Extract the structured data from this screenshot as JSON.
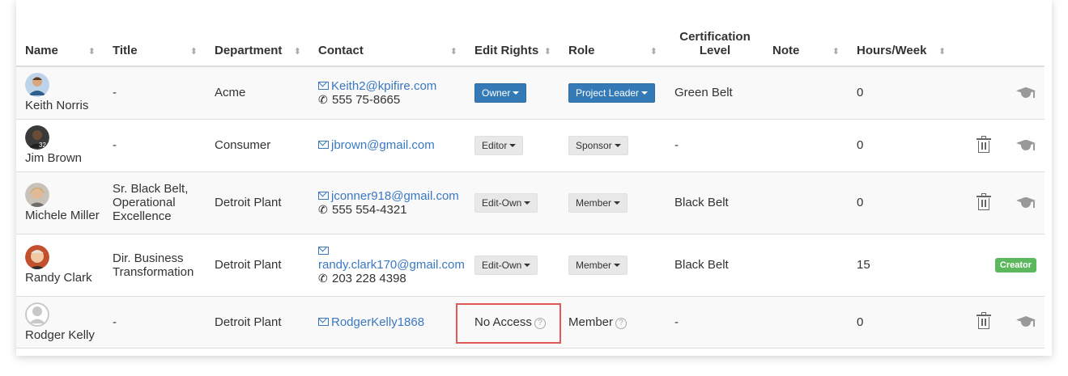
{
  "table": {
    "headers": {
      "name": "Name",
      "title": "Title",
      "department": "Department",
      "contact": "Contact",
      "edit_rights": "Edit Rights",
      "role": "Role",
      "certification_line1": "Certification",
      "certification_line2": "Level",
      "note": "Note",
      "hours": "Hours/Week"
    },
    "sort_glyph": "⬍",
    "rows": [
      {
        "name": "Keith Norris",
        "title": "-",
        "department": "Acme",
        "email": "Keith2@kpifire.com",
        "phone": "555 75-8665",
        "edit_rights": "Owner",
        "role": "Project Leader",
        "certification": "Green Belt",
        "hours": "0"
      },
      {
        "name": "Jim Brown",
        "title": "-",
        "department": "Consumer",
        "email": "jbrown@gmail.com",
        "edit_rights": "Editor",
        "role": "Sponsor",
        "certification": "-",
        "hours": "0"
      },
      {
        "name": "Michele Miller",
        "title_line1": "Sr. Black Belt,",
        "title_line2": "Operational",
        "title_line3": "Excellence",
        "department": "Detroit Plant",
        "email": "jconner918@gmail.com",
        "phone": "555 554-4321",
        "edit_rights": "Edit-Own",
        "role": "Member",
        "certification": "Black Belt",
        "hours": "0"
      },
      {
        "name": "Randy Clark",
        "title_line1": "Dir. Business",
        "title_line2": "Transformation",
        "department": "Detroit Plant",
        "email": "randy.clark170@gmail.com",
        "phone": "203 228 4398",
        "edit_rights": "Edit-Own",
        "role": "Member",
        "certification": "Black Belt",
        "hours": "15",
        "badge": "Creator"
      },
      {
        "name": "Rodger Kelly",
        "title": "-",
        "department": "Detroit Plant",
        "email": "RodgerKelly1868",
        "edit_rights": "No Access",
        "role": "Member",
        "certification": "-",
        "hours": "0"
      }
    ]
  },
  "icons": {
    "email": "envelope-icon",
    "phone": "phone-icon",
    "delete": "trash-icon",
    "certification": "graduation-cap-icon",
    "help": "question-circle-icon"
  },
  "help_glyph": "?",
  "colors": {
    "primary_button": "#337ab7",
    "link": "#3a78c2",
    "badge_green": "#5cb85c",
    "highlight_red": "#e05a5a"
  }
}
